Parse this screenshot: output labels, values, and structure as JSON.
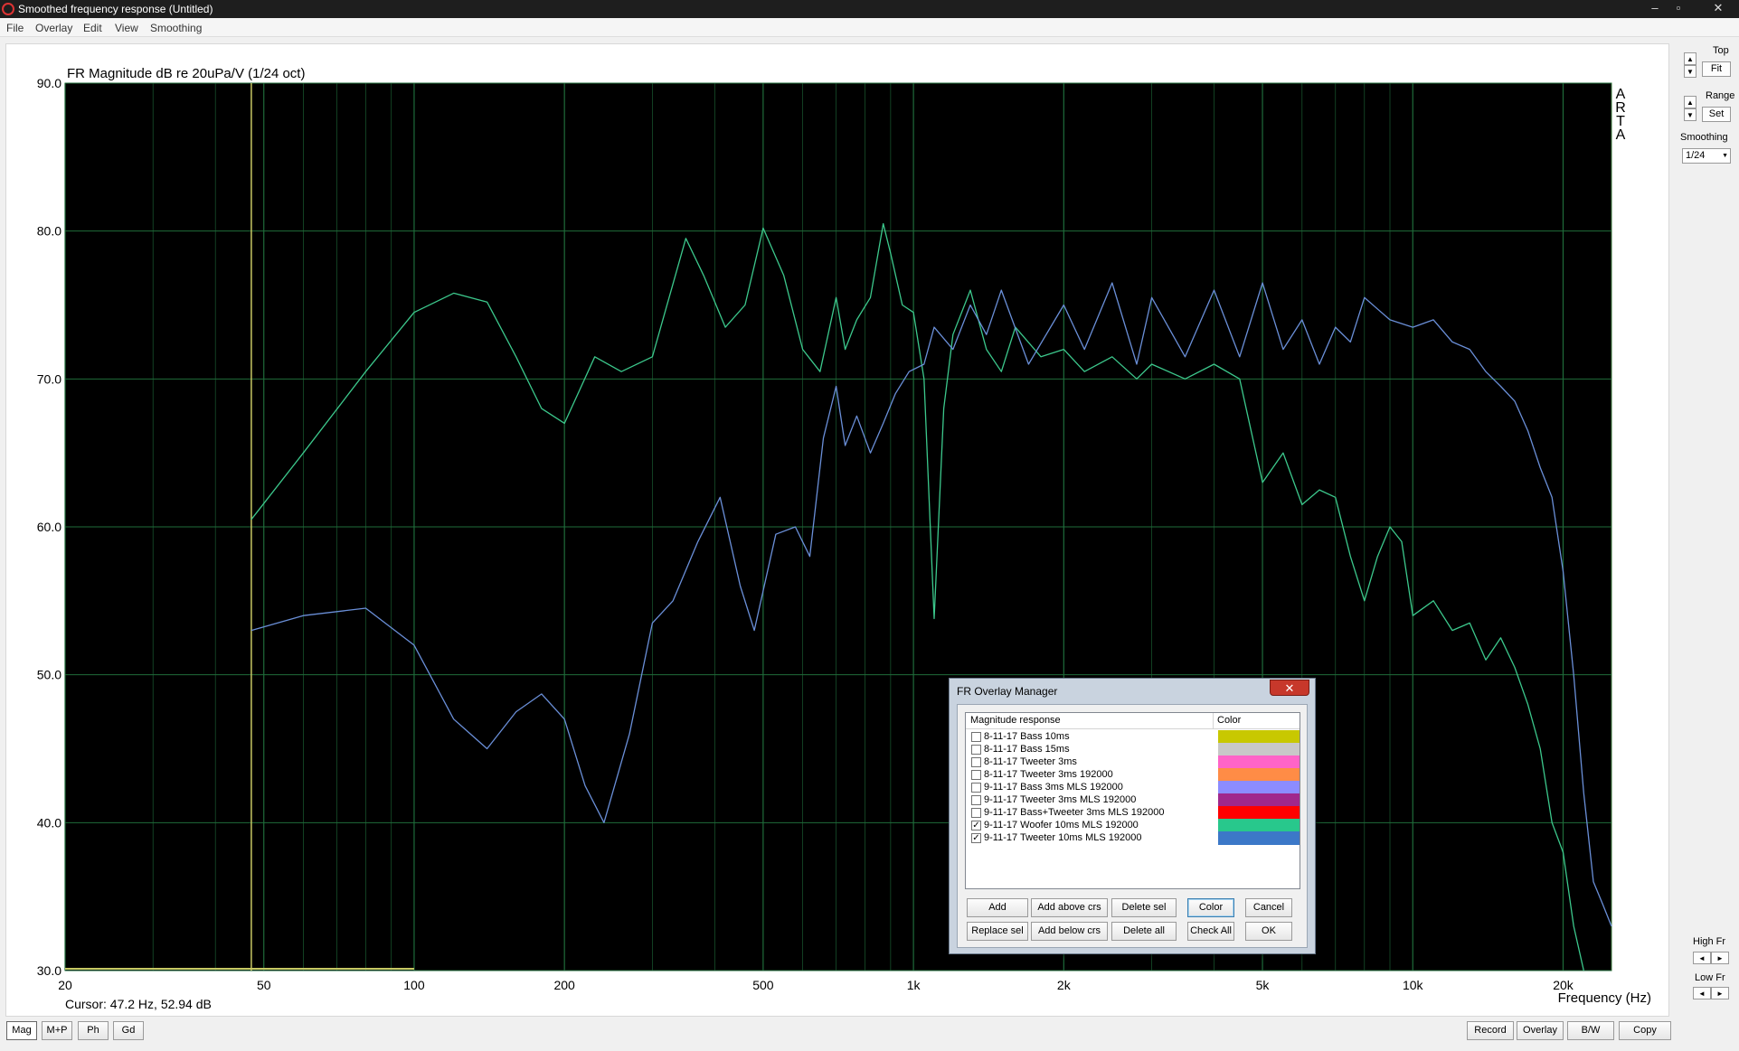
{
  "window": {
    "title": "Smoothed frequency response (Untitled)",
    "minimize": "–",
    "maximize": "▫",
    "close": "✕"
  },
  "menu": [
    "File",
    "Overlay",
    "Edit",
    "View",
    "Smoothing"
  ],
  "chart_data": {
    "type": "line",
    "title": "FR Magnitude dB re 20uPa/V (1/24 oct)",
    "xlabel": "Frequency (Hz)",
    "ylabel": "",
    "xscale": "log",
    "xlim": [
      20,
      25000
    ],
    "ylim": [
      30,
      90
    ],
    "yticks": [
      30,
      40,
      50,
      60,
      70,
      80,
      90
    ],
    "ytick_labels": [
      "30.0",
      "40.0",
      "50.0",
      "60.0",
      "70.0",
      "80.0",
      "90.0"
    ],
    "xtick_values": [
      20,
      50,
      100,
      200,
      500,
      1000,
      2000,
      5000,
      10000,
      20000
    ],
    "xtick_labels": [
      "20",
      "50",
      "100",
      "200",
      "500",
      "1k",
      "2k",
      "5k",
      "10k",
      "20k"
    ],
    "grid": true,
    "background": "#000000",
    "grid_color": "#1f6b3a",
    "cursor": {
      "x": 47.2,
      "color": "#c8c864"
    },
    "cursor_text": "Cursor: 47.2 Hz, 52.94 dB",
    "watermark": [
      "A",
      "R",
      "T",
      "A"
    ],
    "series": [
      {
        "color": "#3cc88c",
        "x": [
          47.2,
          60,
          80,
          100,
          120,
          140,
          160,
          180,
          200,
          230,
          260,
          300,
          350,
          380,
          420,
          460,
          500,
          550,
          600,
          650,
          700,
          730,
          770,
          820,
          870,
          900,
          950,
          1000,
          1050,
          1100,
          1150,
          1200,
          1300,
          1400,
          1500,
          1600,
          1800,
          2000,
          2200,
          2500,
          2800,
          3000,
          3500,
          4000,
          4500,
          5000,
          5500,
          6000,
          6500,
          7000,
          7500,
          8000,
          8500,
          9000,
          9500,
          10000,
          11000,
          12000,
          13000,
          14000,
          15000,
          16000,
          17000,
          18000,
          19000,
          20000,
          21000,
          22000
        ],
        "y": [
          60.5,
          65.0,
          70.5,
          74.5,
          75.8,
          75.2,
          71.5,
          68.0,
          67.0,
          71.5,
          70.5,
          71.5,
          79.5,
          77.0,
          73.5,
          75.0,
          80.2,
          77.0,
          72.0,
          70.5,
          75.5,
          72.0,
          74.0,
          75.5,
          80.5,
          78.5,
          75.0,
          74.5,
          70.0,
          53.8,
          68.0,
          73.0,
          76.0,
          72.0,
          70.5,
          73.5,
          71.5,
          72.0,
          70.5,
          71.5,
          70.0,
          71.0,
          70.0,
          71.0,
          70.0,
          63.0,
          65.0,
          61.5,
          62.5,
          62.0,
          58.0,
          55.0,
          58.0,
          60.0,
          59.0,
          54.0,
          55.0,
          53.0,
          53.5,
          51.0,
          52.5,
          50.5,
          48.0,
          45.0,
          40.0,
          38.0,
          33.0,
          30.0
        ]
      },
      {
        "color": "#6a8fd8",
        "x": [
          47.2,
          60,
          80,
          100,
          120,
          140,
          160,
          180,
          200,
          220,
          240,
          270,
          300,
          330,
          370,
          410,
          450,
          480,
          530,
          580,
          620,
          660,
          700,
          730,
          770,
          820,
          870,
          920,
          980,
          1050,
          1100,
          1200,
          1300,
          1400,
          1500,
          1700,
          2000,
          2200,
          2500,
          2800,
          3000,
          3500,
          4000,
          4500,
          5000,
          5500,
          6000,
          6500,
          7000,
          7500,
          8000,
          9000,
          10000,
          11000,
          12000,
          13000,
          14000,
          15000,
          16000,
          17000,
          18000,
          19000,
          20000,
          21000,
          22000,
          23000,
          24000,
          25000
        ],
        "y": [
          53.0,
          54.0,
          54.5,
          52.0,
          47.0,
          45.0,
          47.5,
          48.7,
          47.0,
          42.5,
          40.0,
          46.0,
          53.5,
          55.0,
          59.0,
          62.0,
          56.0,
          53.0,
          59.5,
          60.0,
          58.0,
          66.0,
          69.5,
          65.5,
          67.5,
          65.0,
          67.0,
          69.0,
          70.5,
          71.0,
          73.5,
          72.0,
          75.0,
          73.0,
          76.0,
          71.0,
          75.0,
          72.0,
          76.5,
          71.0,
          75.5,
          71.5,
          76.0,
          71.5,
          76.5,
          72.0,
          74.0,
          71.0,
          73.5,
          72.5,
          75.5,
          74.0,
          73.5,
          74.0,
          72.5,
          72.0,
          70.5,
          69.5,
          68.5,
          66.5,
          64.0,
          62.0,
          57.0,
          50.0,
          42.0,
          36.0,
          34.5,
          33.0
        ]
      }
    ]
  },
  "side": {
    "top_label": "Top",
    "fit_label": "Fit",
    "range_label": "Range",
    "set_label": "Set",
    "smoothing_label": "Smoothing",
    "smoothing_value": "1/24",
    "highfr_label": "High Fr",
    "lowfr_label": "Low Fr",
    "up": "▲",
    "down": "▼",
    "left": "◄",
    "right": "►",
    "dropdown": "▼"
  },
  "bottom": {
    "left_buttons": [
      "Mag",
      "M+P",
      "Ph",
      "Gd"
    ],
    "right_buttons": [
      "Record",
      "Overlay",
      "B/W",
      "Copy"
    ]
  },
  "dialog": {
    "title": "FR Overlay Manager",
    "close": "✕",
    "col_response": "Magnitude response",
    "col_color": "Color",
    "rows": [
      {
        "label": "8-11-17 Bass 10ms",
        "checked": false,
        "color": "#c8c800"
      },
      {
        "label": "8-11-17 Bass 15ms",
        "checked": false,
        "color": "#c8c8c8"
      },
      {
        "label": "8-11-17 Tweeter 3ms",
        "checked": false,
        "color": "#ff64c8"
      },
      {
        "label": "8-11-17 Tweeter 3ms 192000",
        "checked": false,
        "color": "#ff8c46"
      },
      {
        "label": "9-11-17 Bass 3ms MLS 192000",
        "checked": false,
        "color": "#8c8cff"
      },
      {
        "label": "9-11-17 Tweeter 3ms MLS 192000",
        "checked": false,
        "color": "#a0288c"
      },
      {
        "label": "9-11-17 Bass+Tweeter 3ms MLS 192000",
        "checked": false,
        "color": "#ff0000"
      },
      {
        "label": "9-11-17 Woofer 10ms MLS 192000",
        "checked": true,
        "color": "#28c88c"
      },
      {
        "label": "9-11-17 Tweeter 10ms MLS 192000",
        "checked": true,
        "color": "#3c78c8"
      }
    ],
    "check_mark": "✓",
    "buttons": {
      "add": "Add",
      "add_above": "Add above crs",
      "delete_sel": "Delete sel",
      "color": "Color",
      "cancel": "Cancel",
      "replace_sel": "Replace sel",
      "add_below": "Add below crs",
      "delete_all": "Delete all",
      "check_all": "Check All",
      "ok": "OK"
    }
  }
}
